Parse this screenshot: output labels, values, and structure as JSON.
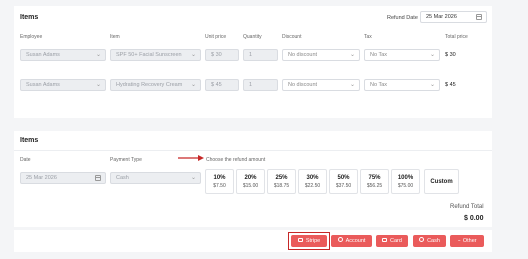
{
  "section1": {
    "title": "Items",
    "refund_date_label": "Refund Date",
    "refund_date_value": "25 Mar 2026",
    "headers": [
      "Employee",
      "Item",
      "Unit price",
      "Quantity",
      "Discount",
      "Tax",
      "Total price"
    ],
    "rows": [
      {
        "employee": "Susan Adams",
        "item": "SPF 50+ Facial Sunscreen",
        "unit_price": "$ 30",
        "quantity": "1",
        "discount": "No discount",
        "tax": "No Tax",
        "total": "$ 30"
      },
      {
        "employee": "Susan Adams",
        "item": "Hydrating Recovery Cream",
        "unit_price": "$ 45",
        "quantity": "1",
        "discount": "No discount",
        "tax": "No Tax",
        "total": "$ 45"
      }
    ]
  },
  "section2": {
    "title": "Items",
    "date_label": "Date",
    "payment_type_label": "Payment Type",
    "choose_label": "Choose the refund amount",
    "date_value": "25 Mar 2026",
    "payment_value": "Cash",
    "percents": [
      {
        "pct": "10%",
        "amount": "$7.50"
      },
      {
        "pct": "20%",
        "amount": "$15.00"
      },
      {
        "pct": "25%",
        "amount": "$18.75"
      },
      {
        "pct": "30%",
        "amount": "$22.50"
      },
      {
        "pct": "50%",
        "amount": "$37.50"
      },
      {
        "pct": "75%",
        "amount": "$56.25"
      },
      {
        "pct": "100%",
        "amount": "$75.00"
      }
    ],
    "custom_label": "Custom",
    "refund_total_label": "Refund Total",
    "refund_total_value": "$ 0.00"
  },
  "buttons": {
    "stripe": "Stripe",
    "account": "Account",
    "card": "Card",
    "cash": "Cash",
    "other": "Other"
  },
  "colors": {
    "accent": "#ea5b5b",
    "highlight": "#c62828"
  }
}
